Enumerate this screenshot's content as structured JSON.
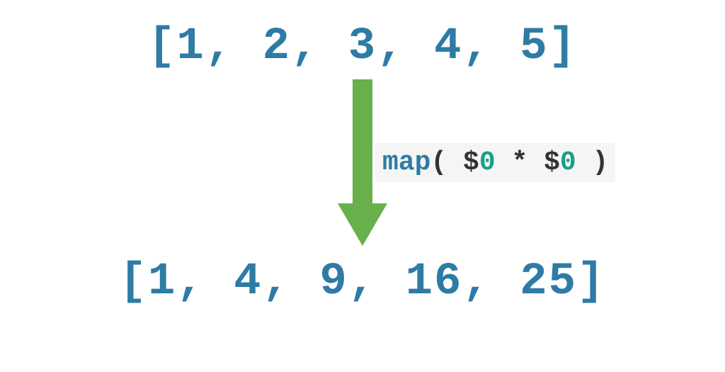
{
  "inputArray": "[1, 2, 3, 4, 5]",
  "outputArray": "[1, 4, 9, 16, 25]",
  "mapExpr": {
    "fn": "map",
    "openParen": "( ",
    "dollar1": "$",
    "zero1": "0",
    "space1": " ",
    "star": "*",
    "space2": " ",
    "dollar2": "$",
    "zero2": "0",
    "closeParen": " )"
  },
  "colors": {
    "accent": "#2e7ba5",
    "arrow": "#67b04b",
    "teal": "#1b9e8a",
    "codeBg": "#f5f5f5"
  }
}
